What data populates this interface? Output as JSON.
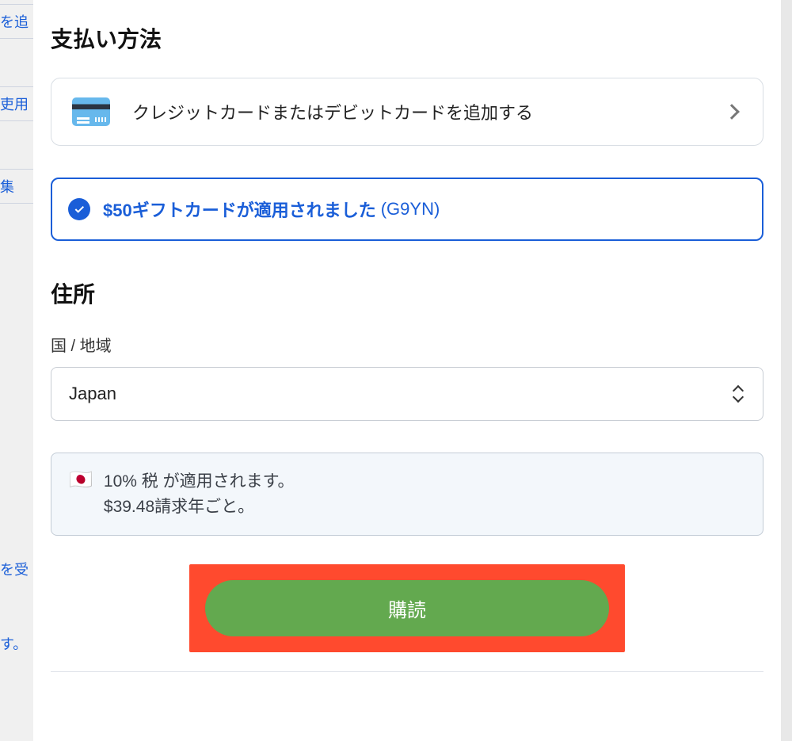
{
  "backdrop": {
    "row1": "を追",
    "row2": "吏用",
    "row3": "集",
    "row4": "を受",
    "row5": "す。"
  },
  "payment": {
    "heading": "支払い方法",
    "add_card_label": "クレジットカードまたはデビットカードを追加する",
    "gift_applied_text": "$50ギフトカードが適用されました",
    "gift_code": "(G9YN)"
  },
  "address": {
    "heading": "住所",
    "country_label": "国 / 地域",
    "country_value": "Japan"
  },
  "tax": {
    "flag": "🇯🇵",
    "line1": "10% 税 が適用されます。",
    "line2": "$39.48請求年ごと。"
  },
  "subscribe": {
    "label": "購読"
  }
}
